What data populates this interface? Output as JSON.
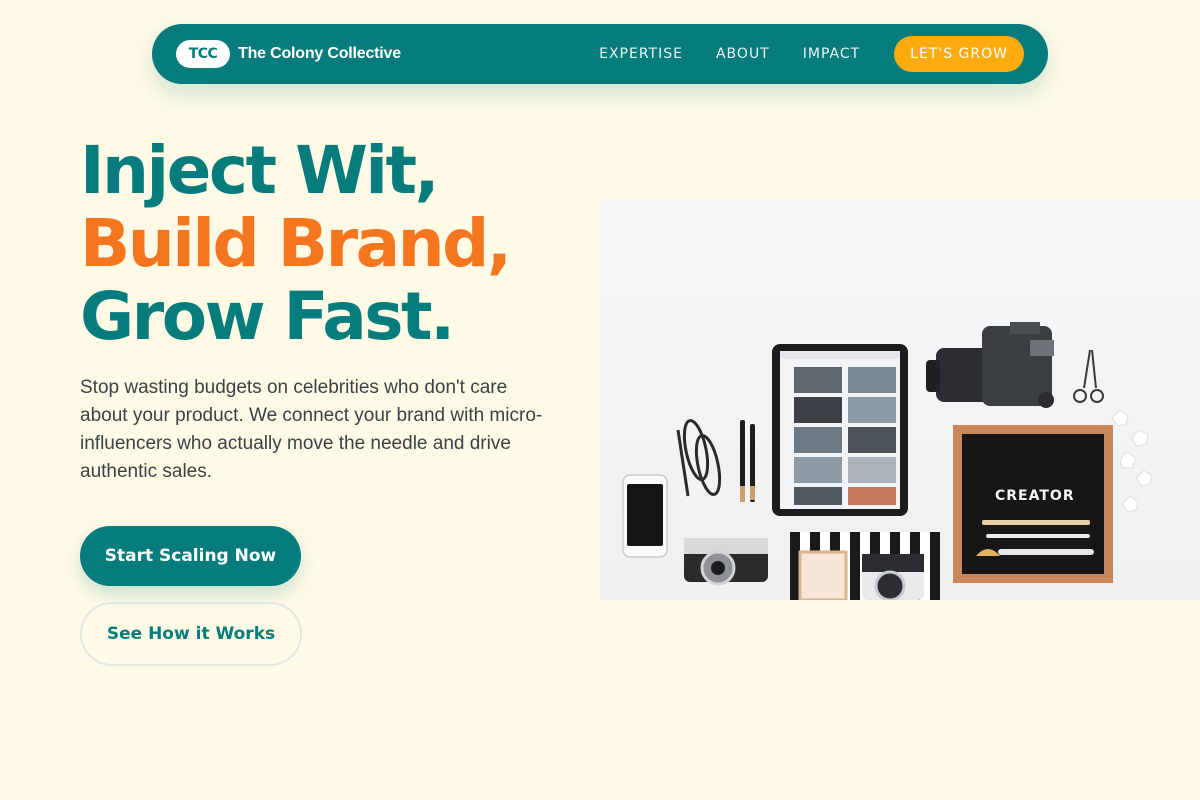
{
  "nav": {
    "logo_text": "TCC",
    "brand_name": "The Colony Collective",
    "links": [
      {
        "label": "EXPERTISE"
      },
      {
        "label": "ABOUT"
      },
      {
        "label": "IMPACT"
      }
    ],
    "cta_label": "LET'S GROW"
  },
  "hero": {
    "headline_line1": "Inject Wit,",
    "headline_line2": "Build Brand,",
    "headline_line3": "Grow Fast.",
    "description": "Stop wasting budgets on celebrities who don't care about your product. We connect your brand with micro-influencers who actually move the needle and drive authentic sales.",
    "primary_button": "Start Scaling Now",
    "secondary_button": "See How it Works",
    "image": {
      "letterboard_text": "CREATOR"
    }
  },
  "colors": {
    "background": "#fefae6",
    "teal": "#067c7c",
    "orange": "#f5761f",
    "cta_yellow": "#fdab0d"
  }
}
